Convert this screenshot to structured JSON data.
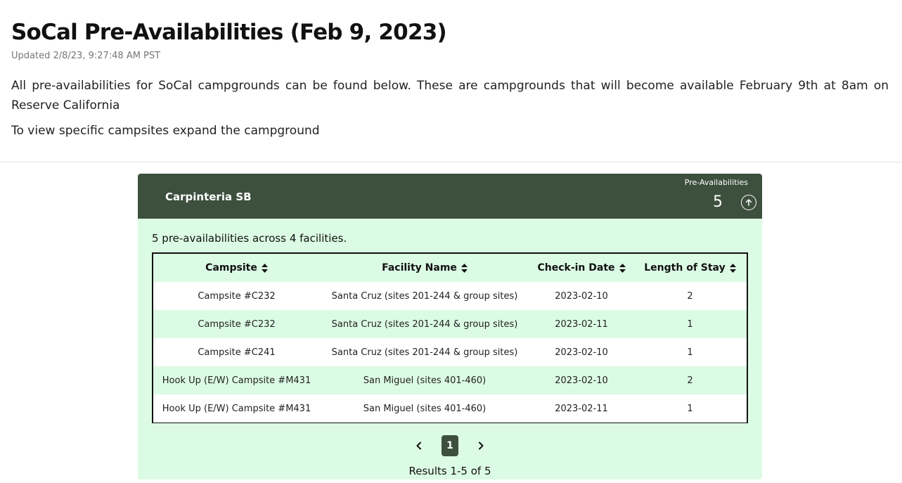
{
  "page": {
    "title": "SoCal Pre-Availabilities (Feb 9, 2023)",
    "updated": "Updated 2/8/23, 9:27:48 AM PST",
    "intro": "All pre-availabilities for SoCal campgrounds can be found below. These are campgrounds that will become available February 9th at 8am on Reserve California",
    "hint": "To view specific campsites expand the campground"
  },
  "campground": {
    "name": "Carpinteria SB",
    "pre_label": "Pre-Availabilities",
    "pre_count": "5",
    "summary": "5 pre-availabilities across 4 facilities.",
    "columns": [
      "Campsite",
      "Facility Name",
      "Check-in Date",
      "Length of Stay"
    ],
    "rows": [
      [
        "Campsite #C232",
        "Santa Cruz (sites 201-244 & group sites)",
        "2023-02-10",
        "2"
      ],
      [
        "Campsite #C232",
        "Santa Cruz (sites 201-244 & group sites)",
        "2023-02-11",
        "1"
      ],
      [
        "Campsite #C241",
        "Santa Cruz (sites 201-244 & group sites)",
        "2023-02-10",
        "1"
      ],
      [
        "Hook Up (E/W) Campsite #M431",
        "San Miguel (sites 401-460)",
        "2023-02-10",
        "2"
      ],
      [
        "Hook Up (E/W) Campsite #M431",
        "San Miguel (sites 401-460)",
        "2023-02-11",
        "1"
      ]
    ],
    "pagination": {
      "current_page": "1",
      "results": "Results 1-5 of 5"
    }
  },
  "icons": {
    "collapse": "arrow-up-circle-icon",
    "sort": "sort-icon",
    "prev": "chevron-left-icon",
    "next": "chevron-right-icon"
  },
  "colors": {
    "header_bg": "#3d4f3d",
    "card_bg": "#dcfbe4",
    "row_alt": "#dcfbe4"
  }
}
